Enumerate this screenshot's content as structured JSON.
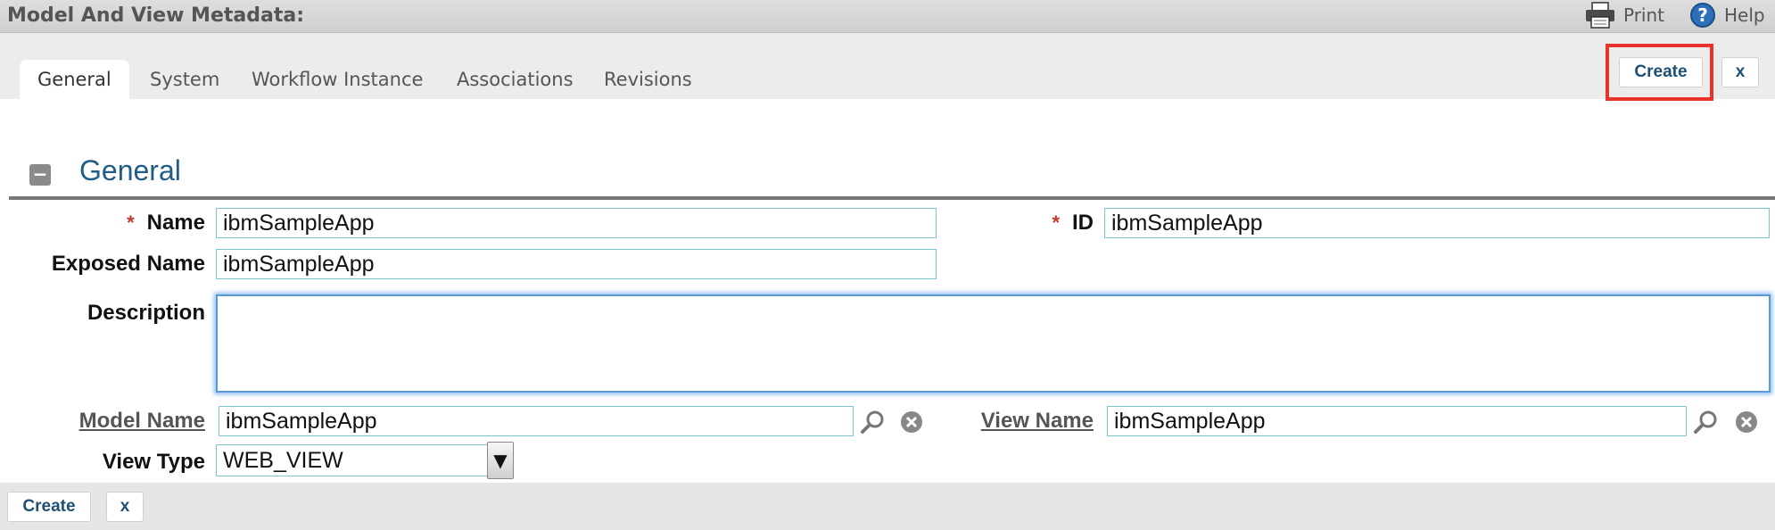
{
  "header": {
    "title": "Model And View Metadata:",
    "print_label": "Print",
    "help_label": "Help"
  },
  "tabs": [
    {
      "label": "General",
      "active": true
    },
    {
      "label": "System"
    },
    {
      "label": "Workflow Instance"
    },
    {
      "label": "Associations"
    },
    {
      "label": "Revisions"
    }
  ],
  "toolbar": {
    "create_label": "Create",
    "close_label": "x"
  },
  "section": {
    "title": "General",
    "collapse_glyph": "−"
  },
  "form": {
    "name_label": "Name",
    "name_value": "ibmSampleApp",
    "id_label": "ID",
    "id_value": "ibmSampleApp",
    "exposed_name_label": "Exposed Name",
    "exposed_name_value": "ibmSampleApp",
    "description_label": "Description",
    "description_value": "",
    "model_name_label": "Model Name",
    "model_name_value": "ibmSampleApp",
    "view_name_label": "View Name",
    "view_name_value": "ibmSampleApp",
    "view_type_label": "View Type",
    "view_type_value": "WEB_VIEW",
    "required_marker": "*"
  },
  "footer": {
    "create_label": "Create",
    "close_label": "x"
  },
  "colors": {
    "accent": "#1f5c87",
    "highlight": "#e8322a",
    "required": "#c0392b"
  }
}
